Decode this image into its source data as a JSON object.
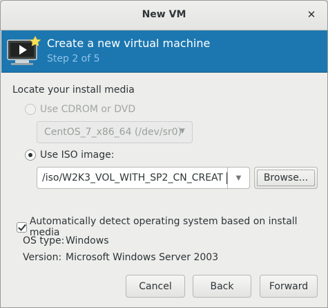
{
  "window": {
    "title": "New VM"
  },
  "header": {
    "title": "Create a new virtual machine",
    "step": "Step 2 of 5"
  },
  "install_media": {
    "label": "Locate your install media",
    "cdrom": {
      "label": "Use CDROM or DVD",
      "selected": false,
      "enabled": false,
      "device": "CentOS_7_x86_64 (/dev/sr0)"
    },
    "iso": {
      "label": "Use ISO image:",
      "selected": true,
      "path": "/iso/W2K3_VOL_WITH_SP2_CN_CREAT",
      "browse_label": "Browse..."
    }
  },
  "auto_detect": {
    "label": "Automatically detect operating system based on install media",
    "checked": true,
    "os_type_key": "OS type:",
    "os_type_value": "Windows",
    "version_key": "Version:",
    "version_value": "Microsoft Windows Server 2003"
  },
  "buttons": {
    "cancel": "Cancel",
    "back": "Back",
    "forward": "Forward"
  },
  "colors": {
    "header_bg": "#1c77b0",
    "step_text": "#8ec3ea"
  }
}
